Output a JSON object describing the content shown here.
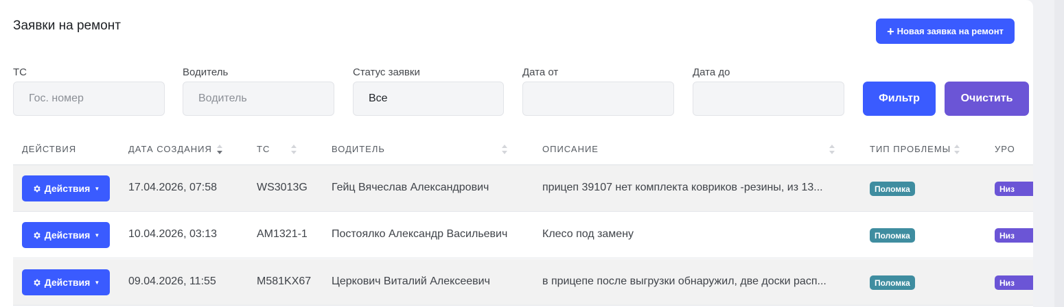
{
  "page": {
    "title": "Заявки на ремонт",
    "new_button_label": "Новая заявка на ремонт"
  },
  "filters": {
    "vehicle": {
      "label": "ТС",
      "placeholder": "Гос. номер",
      "value": ""
    },
    "driver": {
      "label": "Водитель",
      "placeholder": "Водитель",
      "value": ""
    },
    "status": {
      "label": "Статус заявки",
      "value": "Все"
    },
    "date_from": {
      "label": "Дата от",
      "value": ""
    },
    "date_to": {
      "label": "Дата до",
      "value": ""
    },
    "filter_button": "Фильтр",
    "clear_button": "Очистить"
  },
  "table": {
    "headers": [
      "Действия",
      "Дата создания",
      "ТС",
      "Водитель",
      "Описание",
      "Тип проблемы",
      "Уро"
    ],
    "actions_label": "Действия",
    "rows": [
      {
        "date": "17.04.2026, 07:58",
        "vehicle": "WS3013G",
        "driver": "Гейц Вячеслав Александрович",
        "description": "прицеп 39107 нет комплекта ковриков -резины, из 13...",
        "problem_type": "Поломка",
        "urgency": "Низ"
      },
      {
        "date": "10.04.2026, 03:13",
        "vehicle": "AM1321-1",
        "driver": "Постоялко Александр Васильевич",
        "description": "Клесо под замену",
        "problem_type": "Поломка",
        "urgency": "Низ"
      },
      {
        "date": "09.04.2026, 11:55",
        "vehicle": "M581KX67",
        "driver": "Церкович Виталий Алексеевич",
        "description": "в прицепе после выгрузки обнаружил, две доски расп...",
        "problem_type": "Поломка",
        "urgency": "Низ"
      }
    ]
  },
  "colors": {
    "primary": "#3a5bff",
    "secondary": "#6b55d6",
    "badge_problem": "#3f8da0"
  },
  "icons": {
    "plus": "plus-icon",
    "gear": "gear-icon",
    "caret": "caret-down-icon",
    "sort": "sort-icon"
  }
}
